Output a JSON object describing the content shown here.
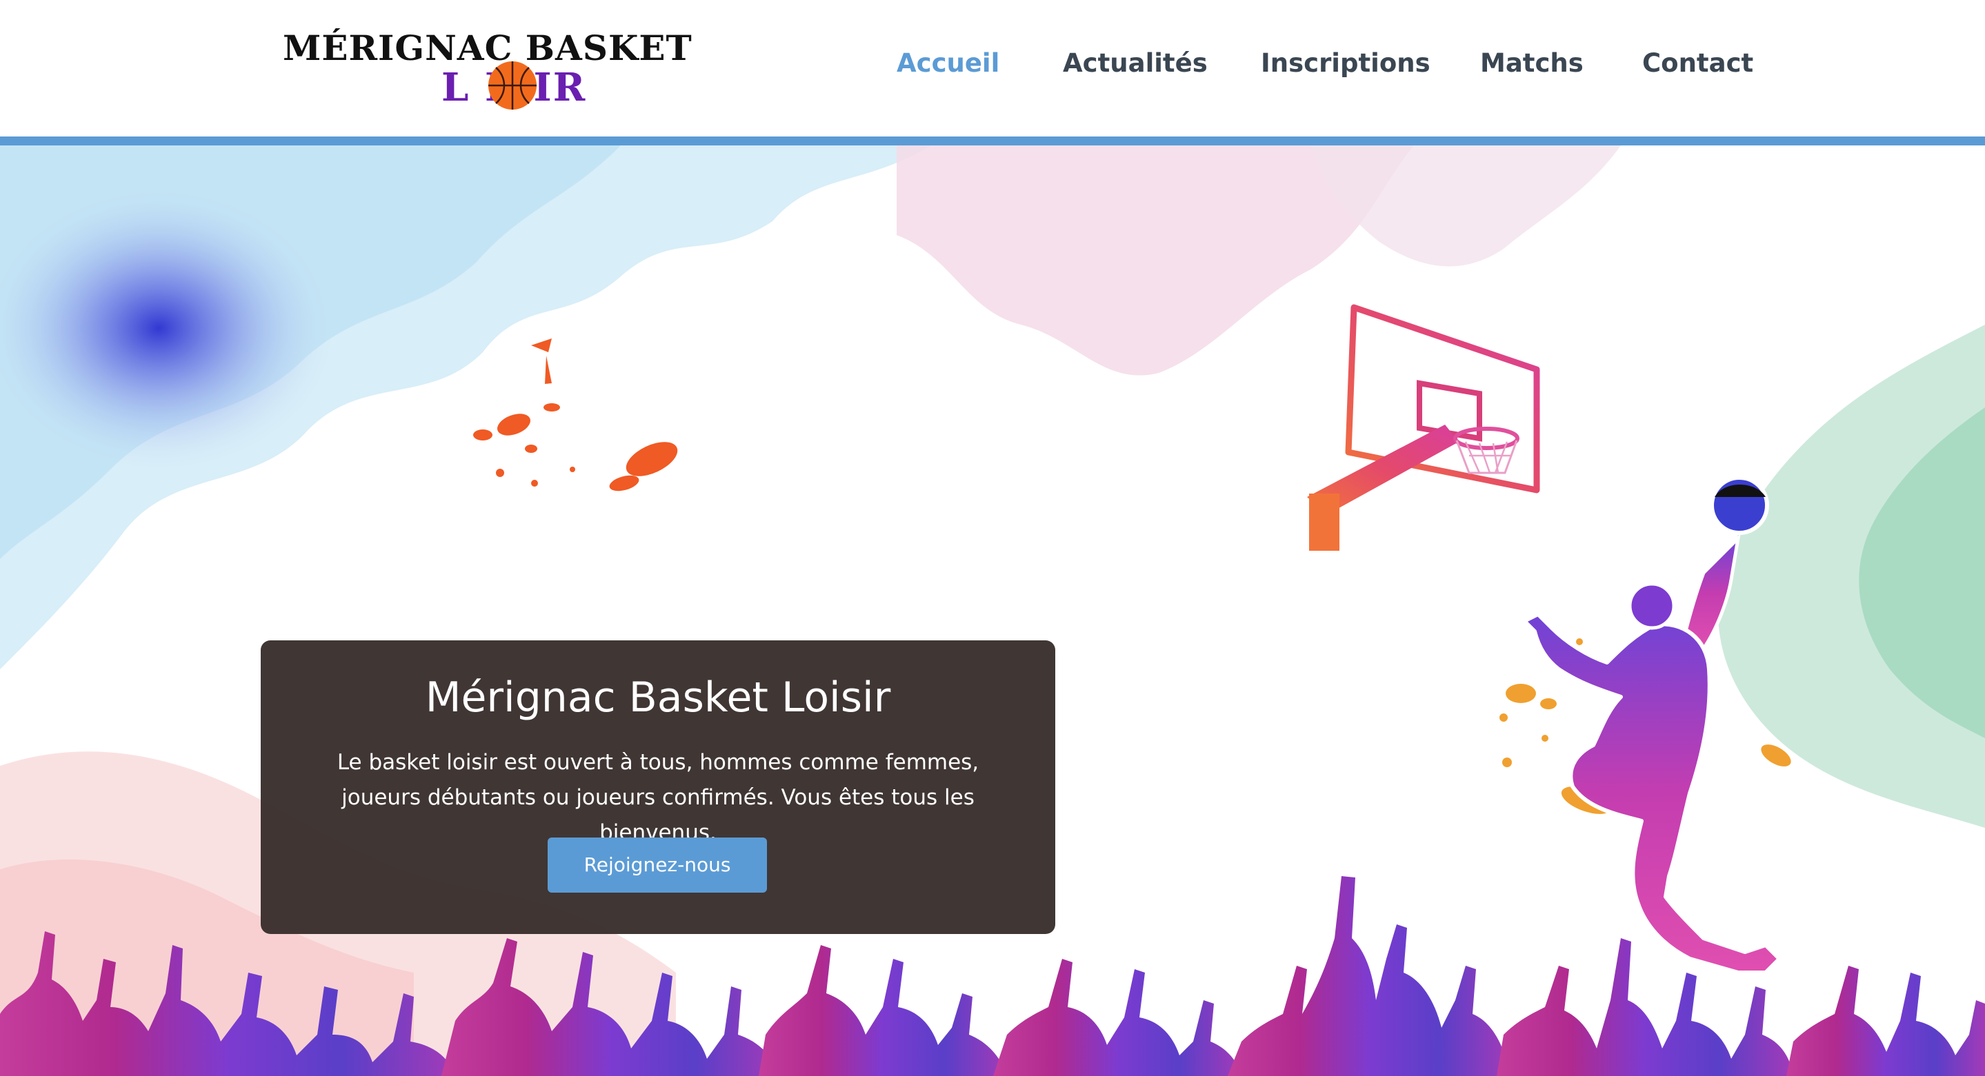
{
  "header": {
    "logo": {
      "line1": "MÉRIGNAC   BASKET",
      "line2": "L   ISIR",
      "alt": "Mérignac Basket Loisir"
    },
    "nav": [
      {
        "label": "Accueil",
        "active": true
      },
      {
        "label": "Actualités",
        "active": false
      },
      {
        "label": "Inscriptions",
        "active": false
      },
      {
        "label": "Matchs",
        "active": false
      },
      {
        "label": "Contact",
        "active": false
      }
    ]
  },
  "hero": {
    "title": "Mérignac Basket Loisir",
    "text": "Le basket loisir est ouvert à tous, hommes comme femmes, joueurs débutants ou joueurs confirmés. Vous êtes tous les bienvenus.",
    "button_label": "Rejoignez-nous"
  },
  "colors": {
    "accent": "#5b9bd5",
    "nav_text": "#3a4652",
    "card_background": "#3a2f2d",
    "logo_purple": "#6a1fb0",
    "ball_orange": "#f26b1d"
  },
  "icons": {
    "logo_ball": "basketball-icon",
    "hoop": "basketball-hoop-illustration",
    "player": "dunking-player-illustration",
    "crowd": "crowd-silhouette-illustration"
  }
}
